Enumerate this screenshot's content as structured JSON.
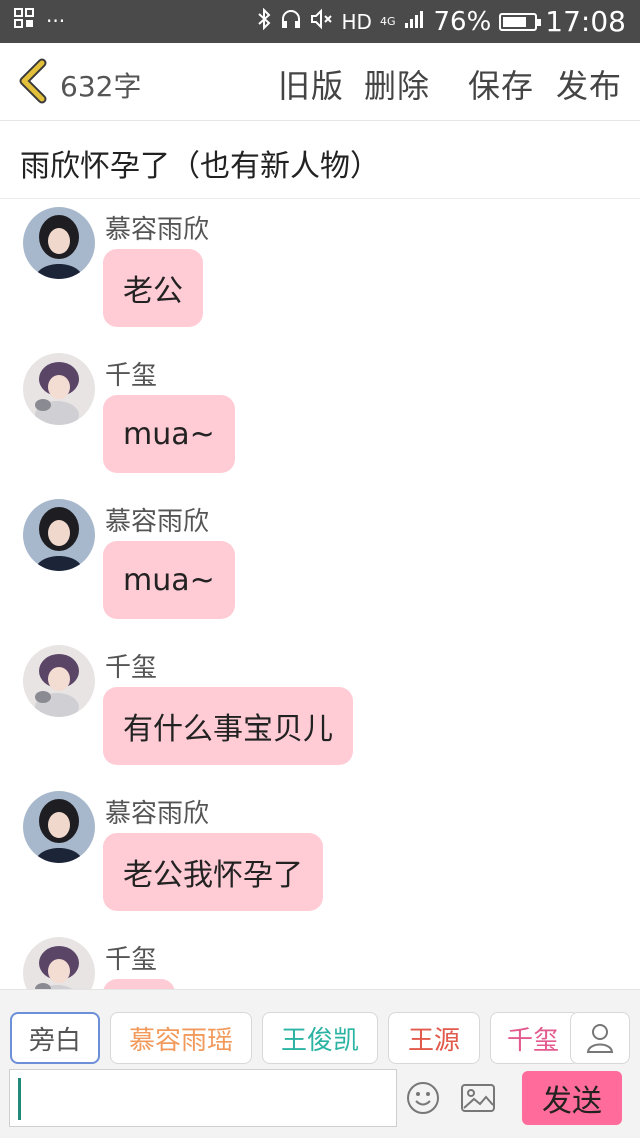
{
  "status_bar": {
    "left_icons": [
      "apps-icon",
      "more-dots-icon"
    ],
    "hd": "HD",
    "network": "4G",
    "battery_level": 0.76,
    "battery_text": "76%",
    "time": "17:08"
  },
  "topbar": {
    "word_count": "632字",
    "old_version": "旧版",
    "delete": "删除",
    "save": "保存",
    "publish": "发布"
  },
  "story": {
    "title": "雨欣怀孕了（也有新人物）"
  },
  "messages": [
    {
      "sender": "慕容雨欣",
      "text": "老公",
      "avatar": "girl-avatar"
    },
    {
      "sender": "千玺",
      "text": "mua~",
      "avatar": "boy-avatar"
    },
    {
      "sender": "慕容雨欣",
      "text": "mua~",
      "avatar": "girl-avatar"
    },
    {
      "sender": "千玺",
      "text": "有什么事宝贝儿",
      "avatar": "boy-avatar"
    },
    {
      "sender": "慕容雨欣",
      "text": "老公我怀孕了",
      "avatar": "girl-avatar"
    },
    {
      "sender": "千玺",
      "text": "",
      "avatar": "boy-avatar"
    }
  ],
  "roles": [
    "旁白",
    "慕容雨瑶",
    "王俊凯",
    "王源",
    "千玺"
  ],
  "colors": {
    "bubble": "#ffccd6",
    "send_button": "#ff6b9a",
    "back_arrow": "#e3c03a",
    "role_narration": "#555555",
    "role_2": "#f29a5c",
    "role_3": "#2bb3a3",
    "role_4": "#e25a4c",
    "role_5": "#e35a8e"
  },
  "input": {
    "placeholder": "",
    "send": "发送"
  }
}
